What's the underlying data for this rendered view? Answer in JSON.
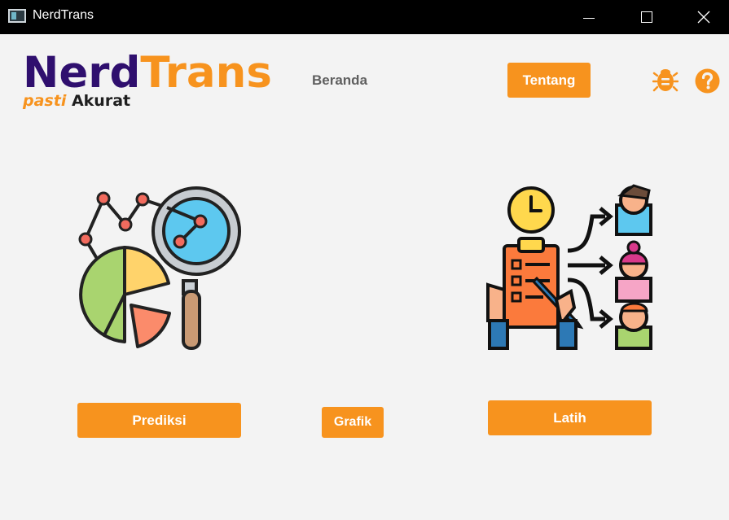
{
  "window": {
    "title": "NerdTrans"
  },
  "logo": {
    "word_primary": "Nerd",
    "word_secondary": "Trans",
    "tagline_primary": "pasti",
    "tagline_secondary": "Akurat"
  },
  "nav": {
    "home_label": "Beranda",
    "about_label": "Tentang"
  },
  "toolbar_icons": [
    "bug-icon",
    "help-icon"
  ],
  "actions": {
    "predict_label": "Prediksi",
    "chart_label": "Grafik",
    "train_label": "Latih"
  },
  "illustrations": [
    "data-analysis-icon",
    "task-assignment-icon"
  ],
  "colors": {
    "accent": "#f7931e",
    "brand_dark": "#2f0f6e",
    "background": "#f3f3f3",
    "titlebar": "#000000"
  }
}
